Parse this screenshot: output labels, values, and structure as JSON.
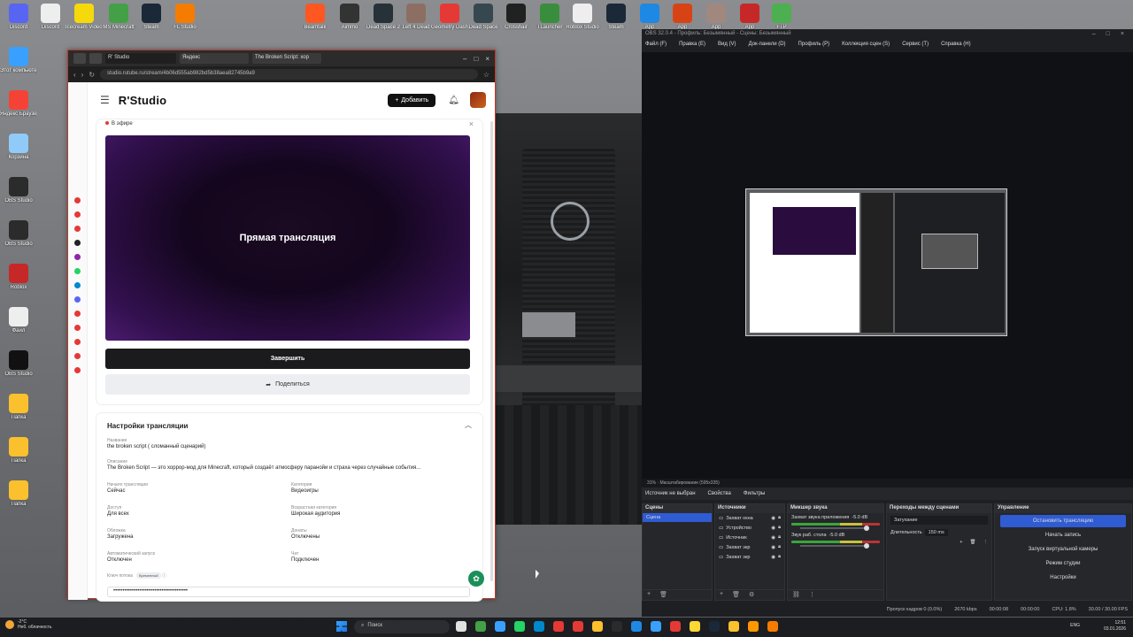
{
  "desktop": {
    "left_icons": [
      {
        "label": "Discord",
        "color": "#5865f2"
      },
      {
        "label": "Этот компьютер",
        "color": "#3aa0ff"
      },
      {
        "label": "Яндекс Браузер",
        "color": "#f44336"
      },
      {
        "label": "Корзина",
        "color": "#90caf9"
      },
      {
        "label": "OBS Studio",
        "color": "#2b2b2b"
      },
      {
        "label": "OBS Studio",
        "color": "#2b2b2b"
      },
      {
        "label": "Roblox",
        "color": "#c62828"
      },
      {
        "label": "Файл",
        "color": "#eeeeee"
      },
      {
        "label": "OBS Studio",
        "color": "#111111"
      },
      {
        "label": "Папка",
        "color": "#fbc02d"
      },
      {
        "label": "Папка",
        "color": "#fbc02d"
      },
      {
        "label": "Папка",
        "color": "#fbc02d"
      }
    ],
    "top_icons": [
      {
        "label": "Discord",
        "color": "#eeeeee"
      },
      {
        "label": "Icecream Video Edit",
        "color": "#f5d90a"
      },
      {
        "label": "MS Minecraft",
        "color": "#43a047"
      },
      {
        "label": "Steam",
        "color": "#1b2838"
      },
      {
        "label": "FL Studio",
        "color": "#f57c00"
      },
      {
        "label": "Beamtalk",
        "color": "#ff5722"
      },
      {
        "label": "Aimmo",
        "color": "#333333"
      },
      {
        "label": "Dead Space 2",
        "color": "#263238"
      },
      {
        "label": "Left 4 Dead",
        "color": "#8d6e63"
      },
      {
        "label": "Geometry Dash",
        "color": "#e53935"
      },
      {
        "label": "Dead Space",
        "color": "#37474f"
      },
      {
        "label": "Crosshair",
        "color": "#212121"
      },
      {
        "label": "TLauncher",
        "color": "#388e3c"
      },
      {
        "label": "Roblox Studio",
        "color": "#eeeeee"
      },
      {
        "label": "Steam",
        "color": "#1b2838"
      },
      {
        "label": "App",
        "color": "#1e88e5"
      },
      {
        "label": "App",
        "color": "#d84315"
      },
      {
        "label": "App",
        "color": "#a1887f"
      },
      {
        "label": "App",
        "color": "#c62828"
      },
      {
        "label": "FTP",
        "color": "#4caf50"
      }
    ]
  },
  "browser": {
    "tabs": [
      "R' Studio",
      "Яндекс",
      "The Broken Script: хор"
    ],
    "url": "studio.rutube.ru/stream/4b06d555ab982bd5b38aea82745b9a9",
    "ext_colors": [
      "#e53935",
      "#e53935",
      "#e53935",
      "#222222",
      "#8e24aa",
      "#25d366",
      "#0088cc",
      "#5865f2",
      "#e53935",
      "#e53935",
      "#e53935",
      "#e53935",
      "#e53935"
    ]
  },
  "studio": {
    "brand": "R'Studio",
    "add_button": "Добавить",
    "live_label": "В эфире",
    "preview_text": "Прямая трансляция",
    "finish_button": "Завершить",
    "share_button": "Поделиться",
    "settings_title": "Настройки трансляции",
    "fields": {
      "name_label": "Название",
      "name_value": "the broken script ( сломанный сценарий)",
      "desc_label": "Описание",
      "desc_value": "The Broken Script — это хоррор-мод для Minecraft, который создаёт атмосферу паранойи и страха через случайные события...",
      "start_label": "Начало трансляции",
      "start_value": "Сейчас",
      "category_label": "Категория",
      "category_value": "Видеоигры",
      "access_label": "Доступ",
      "access_value": "Для всех",
      "age_label": "Возрастная категория",
      "age_value": "Широкая аудитория",
      "cover_label": "Обложка",
      "cover_value": "Загружена",
      "donate_label": "Донаты",
      "donate_value": "Отключены",
      "autoclip_label": "Автоматический запуск",
      "autoclip_value": "Отключен",
      "chat_label": "Чат",
      "chat_value": "Подключен",
      "key_label": "Ключ потока",
      "key_badge": "Временный"
    },
    "stream_key": "••••••••••••••••••••••••••••••••••••••••"
  },
  "obs": {
    "title": "OBS 32.0.4 - Профиль: Безымянный - Сцены: Безымянный",
    "menu": [
      "Файл (F)",
      "Правка (E)",
      "Вид (V)",
      "Док-панели (D)",
      "Профиль (P)",
      "Коллекция сцен (S)",
      "Сервис (T)",
      "Справка (H)"
    ],
    "status_strip": "31% · Масштабирование (595x335)",
    "source_bar": {
      "none": "Источник не выбран",
      "props": "Свойства",
      "filters": "Фильтры"
    },
    "docks": {
      "scenes": {
        "title": "Сцены",
        "items": [
          "Сцена"
        ]
      },
      "sources": {
        "title": "Источники",
        "items": [
          "Захват окна",
          "Устройство",
          "Источник",
          "Захват экр",
          "Захват экр"
        ]
      },
      "mixer": {
        "title": "Микшер звука",
        "ch1": "Захват звука приложения",
        "ch1_db": "-5.0 dB",
        "ch2": "Звук раб. стола",
        "ch2_db": "-5.0 dB"
      },
      "transitions": {
        "title": "Переходы между сценами",
        "type": "Затухание",
        "duration_label": "Длительность",
        "duration": "150 ms"
      },
      "controls": {
        "title": "Управление",
        "buttons": [
          "Остановить трансляцию",
          "Начать запись",
          "Запуск виртуальной камеры",
          "Режим студии",
          "Настройки"
        ]
      }
    },
    "bottom_status": [
      "Пропуск кадров 0 (0.0%)",
      "2670 kbps",
      "00:00:08",
      "00:00:00",
      "CPU: 1.8%",
      "30.00 / 30.00 FPS"
    ]
  },
  "taskbar": {
    "weather_temp": "-2°C",
    "weather_desc": "Неб. облачность",
    "search_placeholder": "Поиск",
    "lang": "ENG",
    "time": "12:51",
    "date": "03.01.2026",
    "apps": [
      "#e0e0e0",
      "#43a047",
      "#3aa0ff",
      "#25d366",
      "#0088cc",
      "#e53935",
      "#e53935",
      "#fbc02d",
      "#2b2b2b",
      "#1e88e5",
      "#3aa0ff",
      "#e53935",
      "#fdd835",
      "#1b2838",
      "#fbc02d",
      "#ff9800",
      "#f57c00"
    ]
  }
}
